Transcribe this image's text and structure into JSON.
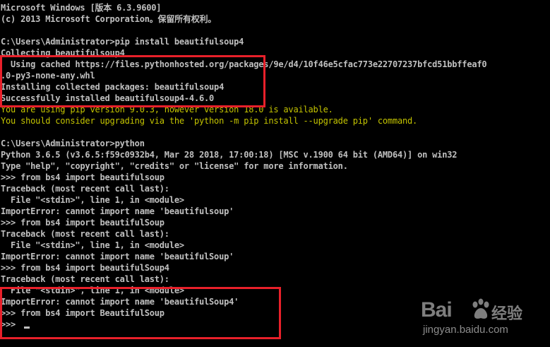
{
  "console": {
    "lines": [
      "Microsoft Windows [版本 6.3.9600]",
      "(c) 2013 Microsoft Corporation。保留所有权利。",
      "",
      "C:\\Users\\Administrator>pip install beautifulsoup4",
      "Collecting beautifulsoup4",
      "  Using cached https://files.pythonhosted.org/packages/9e/d4/10f46e5cfac773e22707237bfcd51bbffeaf0",
      ".0-py3-none-any.whl",
      "Installing collected packages: beautifulsoup4",
      "Successfully installed beautifulsoup4-4.6.0",
      "You are using pip version 9.0.3, however version 18.0 is available.",
      "You should consider upgrading via the 'python -m pip install --upgrade pip' command.",
      "",
      "C:\\Users\\Administrator>python",
      "Python 3.6.5 (v3.6.5:f59c0932b4, Mar 28 2018, 17:00:18) [MSC v.1900 64 bit (AMD64)] on win32",
      "Type \"help\", \"copyright\", \"credits\" or \"license\" for more information.",
      ">>> from bs4 import beautifulsoup",
      "Traceback (most recent call last):",
      "  File \"<stdin>\", line 1, in <module>",
      "ImportError: cannot import name 'beautifulsoup'",
      ">>> from bs4 import beautifulSoup",
      "Traceback (most recent call last):",
      "  File \"<stdin>\", line 1, in <module>",
      "ImportError: cannot import name 'beautifulSoup'",
      ">>> from bs4 import beautifulSoup4",
      "Traceback (most recent call last):",
      "  File \"<stdin>\", line 1, in <module>",
      "ImportError: cannot import name 'beautifulSoup4'",
      ">>> from bs4 import BeautifulSoup",
      ">>> "
    ],
    "warning_line_indices": [
      9,
      10
    ]
  },
  "colors": {
    "background": "#000000",
    "text": "#c0c0c0",
    "warning": "#c4c400",
    "highlight_box": "#e8202a"
  },
  "watermark": {
    "logo": "Bai",
    "logo_suffix": "经验",
    "url": "jingyan.baidu.com",
    "icon": "baidu-paw-icon"
  }
}
